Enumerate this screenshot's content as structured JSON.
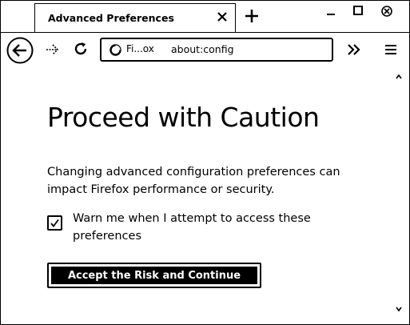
{
  "tab": {
    "title": "Advanced Preferences"
  },
  "toolbar": {
    "site_label": "Fi...ox",
    "url": "about:config"
  },
  "icons": {
    "back": "back-arrow-icon",
    "forward": "forward-arrow-icon",
    "reload": "reload-icon",
    "site": "firefox-logo-icon",
    "overflow": "double-chevron-icon",
    "menu": "hamburger-menu-icon",
    "new_tab": "plus-icon",
    "tab_close": "close-icon"
  },
  "page": {
    "heading": "Proceed with Caution",
    "description": "Changing advanced configuration preferences can impact Firefox performance or security.",
    "checkbox_label": "Warn me when I attempt to access these preferences",
    "checkbox_checked": true,
    "accept_button": "Accept the Risk and Continue"
  },
  "colors": {
    "ink": "#000000",
    "background": "#ffffff"
  }
}
